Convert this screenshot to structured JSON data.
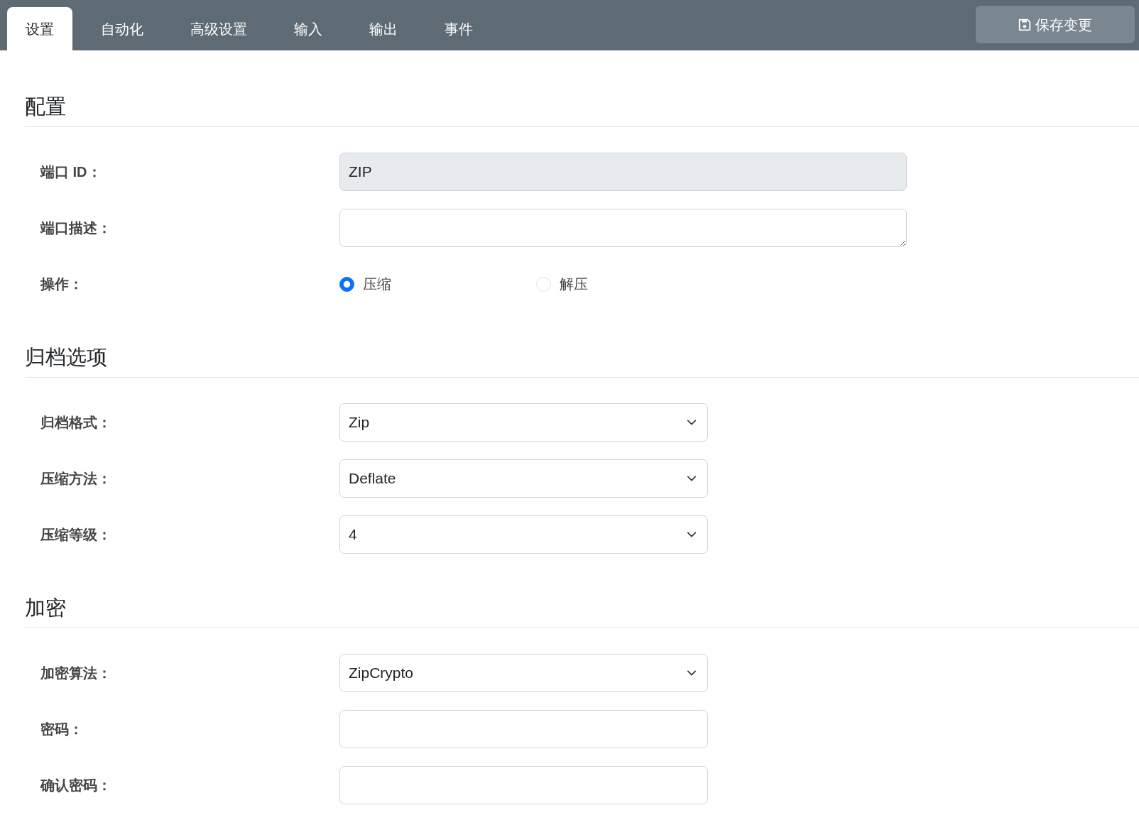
{
  "tabs": [
    {
      "label": "设置",
      "selected": true
    },
    {
      "label": "自动化",
      "selected": false
    },
    {
      "label": "高级设置",
      "selected": false
    },
    {
      "label": "输入",
      "selected": false
    },
    {
      "label": "输出",
      "selected": false
    },
    {
      "label": "事件",
      "selected": false
    }
  ],
  "save_button": {
    "label": "保存变更"
  },
  "sections": [
    {
      "title": "配置",
      "fields": [
        {
          "kind": "text",
          "label": "端口 ID：",
          "value": "ZIP",
          "disabled": true,
          "wide": true
        },
        {
          "kind": "textarea",
          "label": "端口描述：",
          "wide": true
        },
        {
          "kind": "radio",
          "label": "操作：",
          "options": [
            {
              "label": "压缩",
              "selected": true
            },
            {
              "label": "解压",
              "selected": false
            }
          ]
        }
      ]
    },
    {
      "title": "归档选项",
      "fields": [
        {
          "kind": "select",
          "label": "归档格式：",
          "value": "Zip"
        },
        {
          "kind": "select",
          "label": "压缩方法：",
          "value": "Deflate"
        },
        {
          "kind": "select",
          "label": "压缩等级：",
          "value": "4"
        }
      ]
    },
    {
      "title": "加密",
      "fields": [
        {
          "kind": "select",
          "label": "加密算法：",
          "value": "ZipCrypto"
        },
        {
          "kind": "password",
          "label": "密码："
        },
        {
          "kind": "password",
          "label": "确认密码："
        }
      ]
    }
  ]
}
